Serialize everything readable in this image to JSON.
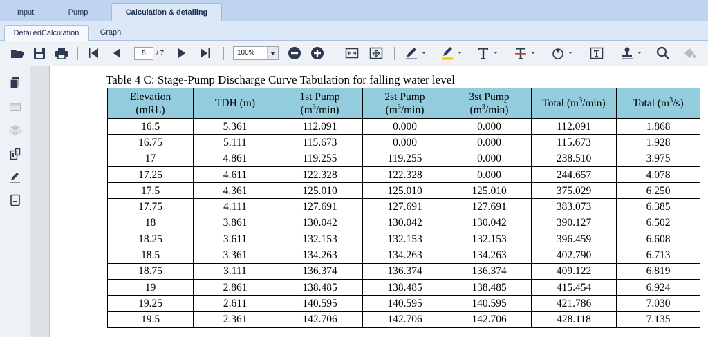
{
  "top_tabs": [
    {
      "label": "Input"
    },
    {
      "label": "Pump"
    },
    {
      "label": "Calculation & detailing"
    }
  ],
  "sub_tabs": [
    {
      "label": "DetailedCalculation"
    },
    {
      "label": "Graph"
    }
  ],
  "toolbar": {
    "page_current": "5",
    "page_total": "/ 7",
    "zoom": "100%"
  },
  "table": {
    "caption": "Table 4 C: Stage-Pump Discharge Curve Tabulation for falling water level",
    "headers": [
      {
        "line1": "Elevation",
        "line2": "(mRL)"
      },
      {
        "line1": "TDH (m)",
        "line2": ""
      },
      {
        "line1": "1st Pump",
        "line2": "(m",
        "sup": "3",
        "tail": "/min)"
      },
      {
        "line1": "2st Pump",
        "line2": "(m",
        "sup": "3",
        "tail": "/min)"
      },
      {
        "line1": "3st Pump",
        "line2": "(m",
        "sup": "3",
        "tail": "/min)"
      },
      {
        "line1": "Total (m",
        "sup": "3",
        "tail1": "/min)",
        "line2": ""
      },
      {
        "line1": "Total (m",
        "sup": "3",
        "tail1": "/s)",
        "line2": ""
      }
    ],
    "rows": [
      [
        "16.5",
        "5.361",
        "112.091",
        "0.000",
        "0.000",
        "112.091",
        "1.868"
      ],
      [
        "16.75",
        "5.111",
        "115.673",
        "0.000",
        "0.000",
        "115.673",
        "1.928"
      ],
      [
        "17",
        "4.861",
        "119.255",
        "119.255",
        "0.000",
        "238.510",
        "3.975"
      ],
      [
        "17.25",
        "4.611",
        "122.328",
        "122.328",
        "0.000",
        "244.657",
        "4.078"
      ],
      [
        "17.5",
        "4.361",
        "125.010",
        "125.010",
        "125.010",
        "375.029",
        "6.250"
      ],
      [
        "17.75",
        "4.111",
        "127.691",
        "127.691",
        "127.691",
        "383.073",
        "6.385"
      ],
      [
        "18",
        "3.861",
        "130.042",
        "130.042",
        "130.042",
        "390.127",
        "6.502"
      ],
      [
        "18.25",
        "3.611",
        "132.153",
        "132.153",
        "132.153",
        "396.459",
        "6.608"
      ],
      [
        "18.5",
        "3.361",
        "134.263",
        "134.263",
        "134.263",
        "402.790",
        "6.713"
      ],
      [
        "18.75",
        "3.111",
        "136.374",
        "136.374",
        "136.374",
        "409.122",
        "6.819"
      ],
      [
        "19",
        "2.861",
        "138.485",
        "138.485",
        "138.485",
        "415.454",
        "6.924"
      ],
      [
        "19.25",
        "2.611",
        "140.595",
        "140.595",
        "140.595",
        "421.786",
        "7.030"
      ],
      [
        "19.5",
        "2.361",
        "142.706",
        "142.706",
        "142.706",
        "428.118",
        "7.135"
      ]
    ]
  },
  "colors": {
    "header_fill": "#93cddd",
    "tab_bar": "#bfd4ef",
    "toolbar": "#eef1f5"
  }
}
